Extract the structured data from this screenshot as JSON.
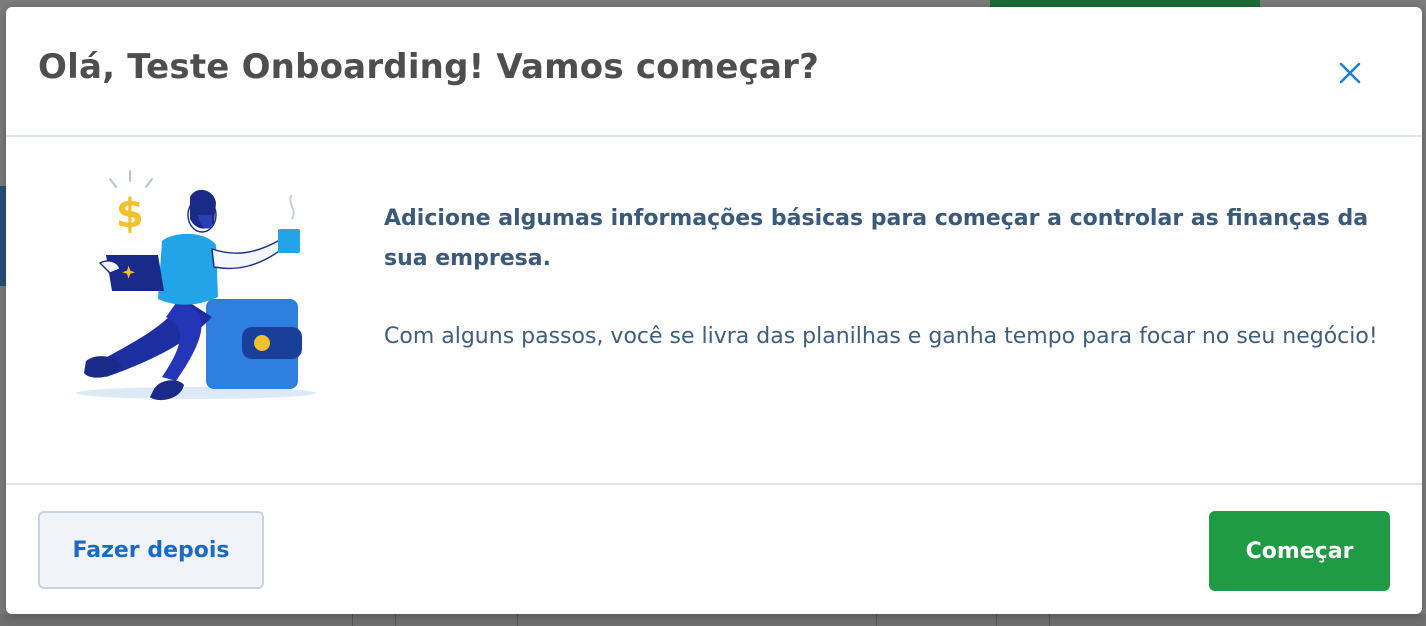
{
  "modal": {
    "title": "Olá, Teste Onboarding! Vamos começar?",
    "close_icon": "close-icon",
    "lead_text": "Adicione algumas informações básicas para começar a controlar as finanças da sua empresa.",
    "secondary_text": "Com alguns passos, você se livra das planilhas e ganha tempo para focar no seu negócio!",
    "illustration_icon": "person-with-wallet-illustration",
    "illustration_symbol": "$"
  },
  "footer": {
    "later_label": "Fazer depois",
    "start_label": "Começar"
  },
  "colors": {
    "title": "#4e4e4e",
    "body_text": "#3a5a7c",
    "primary_button": "#1f9a45",
    "secondary_button_text": "#1b6ac4",
    "close_icon": "#1b7fd6",
    "overlay": "#7c7c7c"
  }
}
